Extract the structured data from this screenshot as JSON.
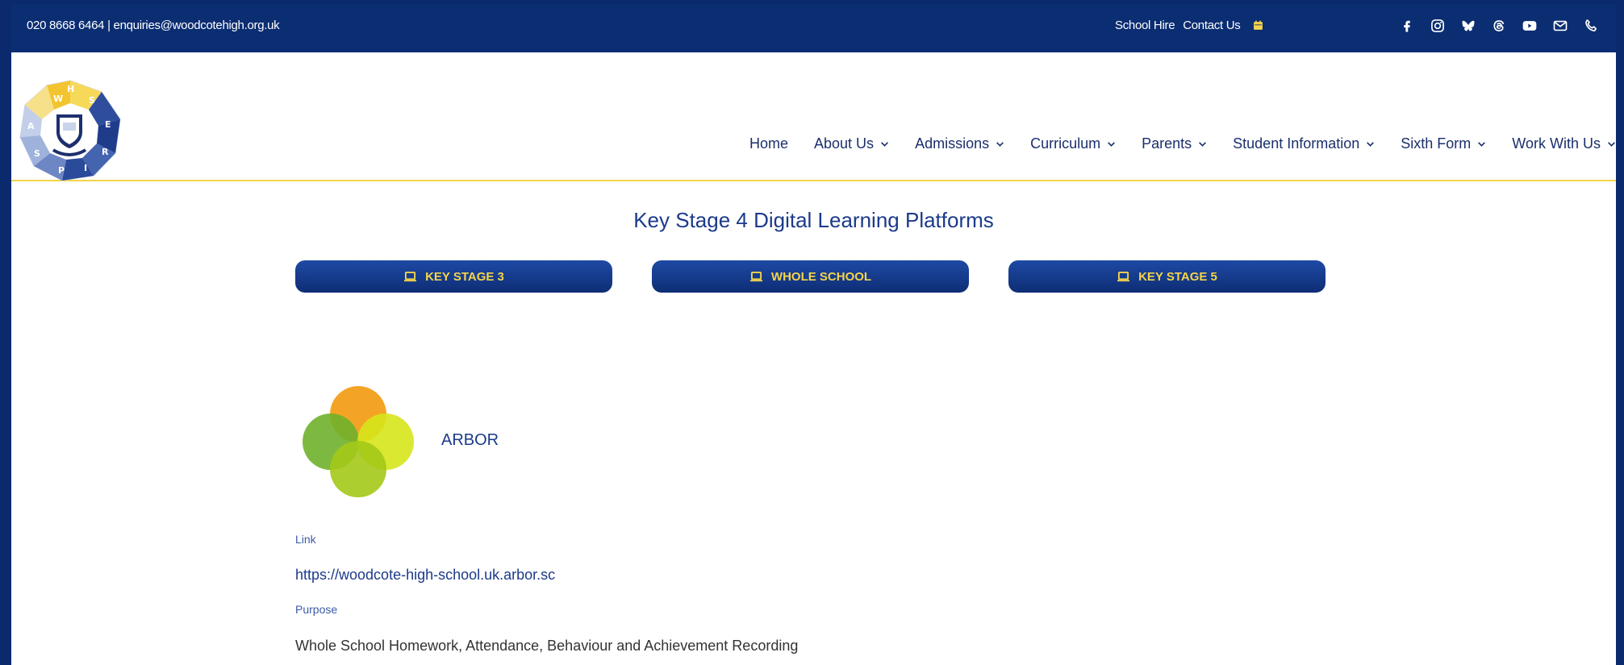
{
  "topbar": {
    "contact": "020 8668 6464 | enquiries@woodcotehigh.org.uk",
    "school_hire": "School Hire",
    "contact_us": "Contact Us",
    "social_icons": [
      "facebook-icon",
      "instagram-icon",
      "bluesky-icon",
      "threads-icon",
      "youtube-icon",
      "email-icon",
      "phone-icon"
    ]
  },
  "logo": {
    "letters": [
      "W",
      "H",
      "S",
      "E",
      "R",
      "I",
      "P",
      "S",
      "A"
    ]
  },
  "nav": {
    "items": [
      {
        "label": "Home"
      },
      {
        "label": "About Us"
      },
      {
        "label": "Admissions"
      },
      {
        "label": "Curriculum"
      },
      {
        "label": "Parents"
      },
      {
        "label": "Student Information"
      },
      {
        "label": "Sixth Form"
      },
      {
        "label": "Work With Us"
      }
    ]
  },
  "page": {
    "title": "Key Stage 4 Digital Learning Platforms",
    "buttons": [
      "KEY STAGE 3",
      "WHOLE SCHOOL",
      "KEY STAGE 5"
    ]
  },
  "platform": {
    "name": "ARBOR",
    "link_label": "Link",
    "link": "https://woodcote-high-school.uk.arbor.sc",
    "purpose_label": "Purpose",
    "purpose": "Whole School Homework, Attendance, Behaviour and Achievement Recording"
  },
  "colors": {
    "navy": "#0b2d72",
    "accent_yellow": "#f4d44a",
    "text_blue": "#1b3a8a"
  }
}
